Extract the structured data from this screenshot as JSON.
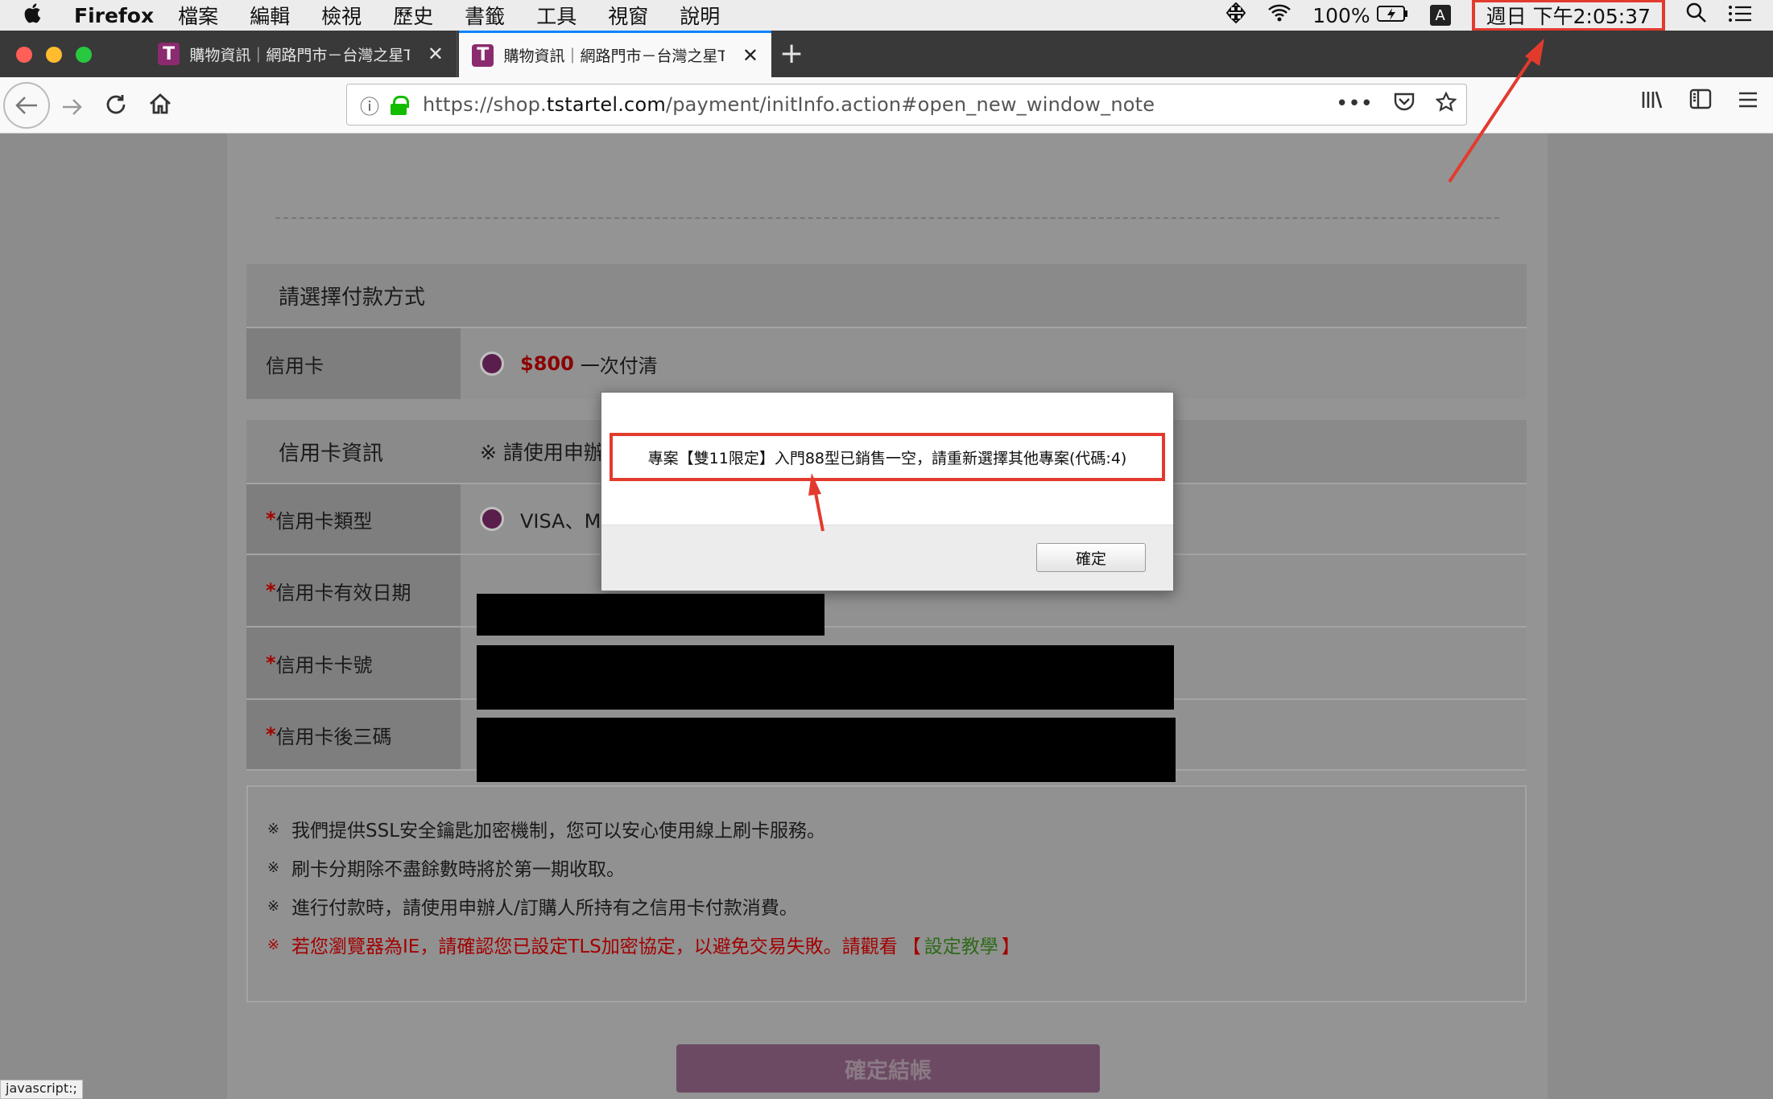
{
  "menubar": {
    "app_name": "Firefox",
    "items": [
      "檔案",
      "編輯",
      "檢視",
      "歷史",
      "書籤",
      "工具",
      "視窗",
      "說明"
    ],
    "battery": "100%",
    "ime": "A",
    "clock": "週日 下午2:05:37"
  },
  "tabs": [
    {
      "favicon": "T",
      "title": "購物資訊｜網路門市－台灣之星T"
    },
    {
      "favicon": "T",
      "title": "購物資訊｜網路門市－台灣之星T"
    }
  ],
  "navbar": {
    "url_prefix": "https://shop.",
    "url_domain": "tstartel.com",
    "url_path": "/payment/initInfo.action#open_new_window_note"
  },
  "payment": {
    "section_title": "請選擇付款方式",
    "label": "信用卡",
    "price": "$800",
    "option": "一次付清"
  },
  "card_info": {
    "section_title": "信用卡資訊",
    "note": "※ 請使用申辦",
    "type_label": "信用卡類型",
    "type_value": "VISA、M",
    "expiry_label": "信用卡有效日期",
    "number_label": "信用卡卡號",
    "cvv_label": "信用卡後三碼",
    "required_mark": "*"
  },
  "notes": {
    "mark": "※",
    "items": [
      "我們提供SSL安全鑰匙加密機制，您可以安心使用線上刷卡服務。",
      "刷卡分期除不盡餘數時將於第一期收取。",
      "進行付款時，請使用申辦人/訂購人所持有之信用卡付款消費。"
    ],
    "warning": "若您瀏覽器為IE，請確認您已設定TLS加密協定，以避免交易失敗。請觀看",
    "warning_link_open": "【",
    "warning_link": "設定教學",
    "warning_link_close": "】"
  },
  "checkout_button": "確定結帳",
  "status_bar": "javascript:;",
  "dialog": {
    "message": "專案【雙11限定】入門88型已銷售一空，請重新選擇其他專案(代碼:4)",
    "ok": "確定"
  },
  "colors": {
    "annotation_red": "#e23b2e",
    "brand_purple": "#8b2a6e",
    "price_red": "#8b0000"
  }
}
